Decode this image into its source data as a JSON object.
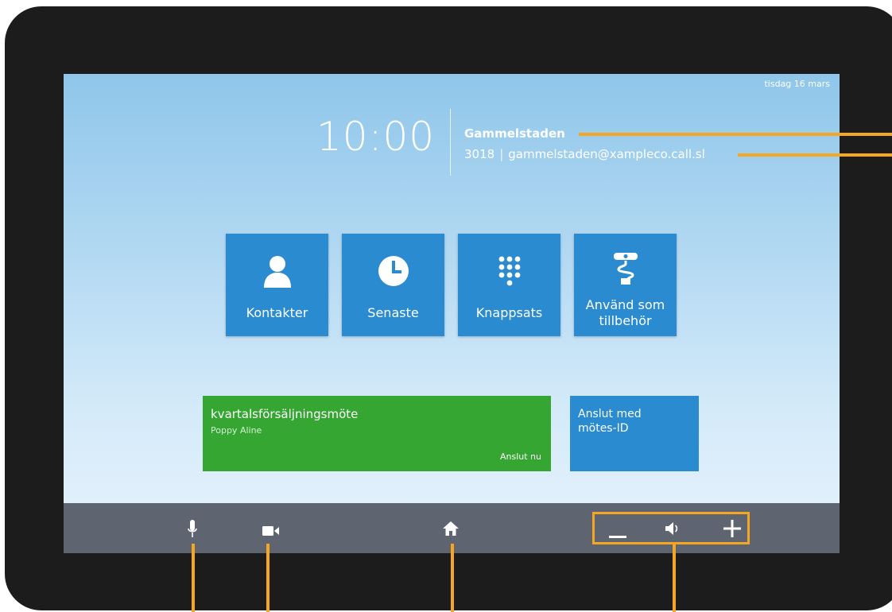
{
  "header": {
    "date": "tisdag 16 mars",
    "time": "10:00",
    "room_name": "Gammelstaden",
    "extension": "3018",
    "separator": "|",
    "sip_address": "gammelstaden@xampleco.call.sl"
  },
  "tiles": [
    {
      "label": "Kontakter",
      "icon": "person-icon"
    },
    {
      "label": "Senaste",
      "icon": "clock-icon"
    },
    {
      "label": "Knappsats",
      "icon": "keypad-icon"
    },
    {
      "label": "Använd som tillbehör",
      "icon": "usb-accessory-icon"
    }
  ],
  "meeting": {
    "title": "kvartalsförsäljningsmöte",
    "organizer": "Poppy Aline",
    "join_label": "Anslut nu"
  },
  "join_by_id": {
    "label": "Anslut med mötes-ID"
  },
  "bottom_bar": {
    "icons": [
      "microphone-icon",
      "video-camera-icon",
      "home-icon",
      "volume-down-icon",
      "speaker-icon",
      "volume-up-icon"
    ]
  },
  "colors": {
    "tile_blue": "#2a8bd0",
    "meeting_green": "#35a631",
    "callout_orange": "#f5a623",
    "bar_gray": "#5f6570"
  }
}
